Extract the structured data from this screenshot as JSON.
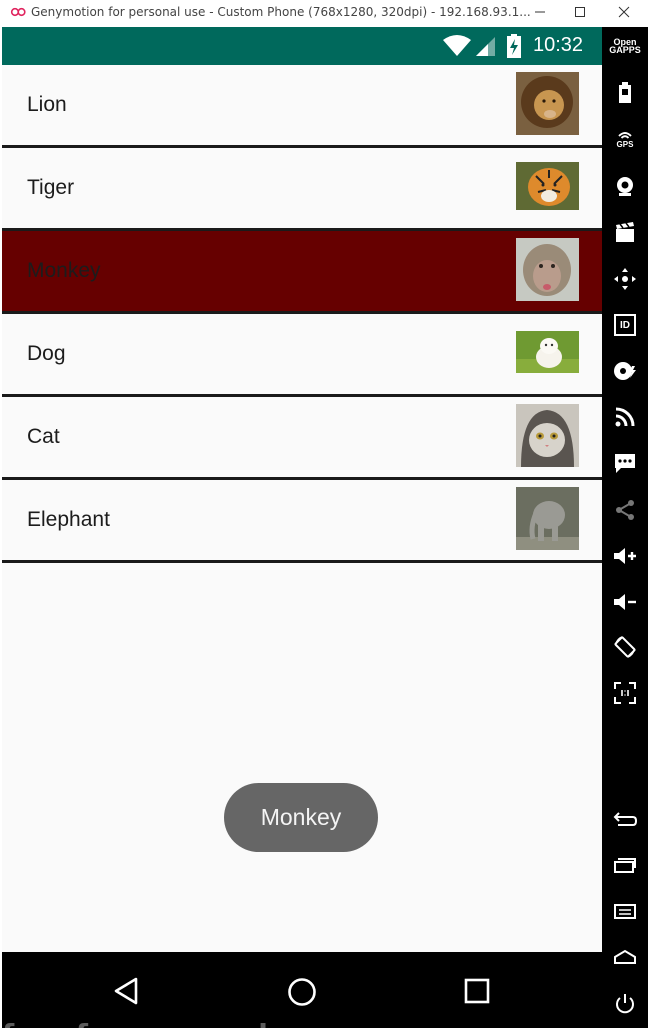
{
  "window": {
    "title": "Genymotion for personal use - Custom Phone (768x1280, 320dpi) - 192.168.93.1...",
    "buttons": [
      "minimize",
      "maximize",
      "close"
    ]
  },
  "statusbar": {
    "time": "10:32",
    "icons": [
      "wifi-icon",
      "signal-icon",
      "battery-charging-icon"
    ],
    "color": "#00695c"
  },
  "list": {
    "items": [
      {
        "label": "Lion",
        "thumb": "lion-photo",
        "selected": false
      },
      {
        "label": "Tiger",
        "thumb": "tiger-photo",
        "selected": false
      },
      {
        "label": "Monkey",
        "thumb": "monkey-photo",
        "selected": true
      },
      {
        "label": "Dog",
        "thumb": "dog-photo",
        "selected": false
      },
      {
        "label": "Cat",
        "thumb": "cat-photo",
        "selected": false
      },
      {
        "label": "Elephant",
        "thumb": "elephant-photo",
        "selected": false
      }
    ],
    "selected_color": "#660000"
  },
  "toast": {
    "text": "Monkey"
  },
  "navbar": {
    "icons": [
      "back-icon",
      "home-icon",
      "recents-icon"
    ]
  },
  "watermark": "free for personal use",
  "sidebar": {
    "open_gapps_label": "Open GAPPS",
    "gps_label": "GPS",
    "id_label": "ID",
    "icons": [
      "open-gapps-icon",
      "battery-icon",
      "gps-icon",
      "webcam-icon",
      "video-capture-icon",
      "dpad-icon",
      "identifiers-icon",
      "disk-io-icon",
      "network-icon",
      "sms-icon",
      "share-icon",
      "volume-up-icon",
      "volume-down-icon",
      "rotate-icon",
      "pixel-perfect-icon",
      "back-icon",
      "recent-apps-icon",
      "menu-icon",
      "home-icon",
      "power-icon"
    ]
  }
}
